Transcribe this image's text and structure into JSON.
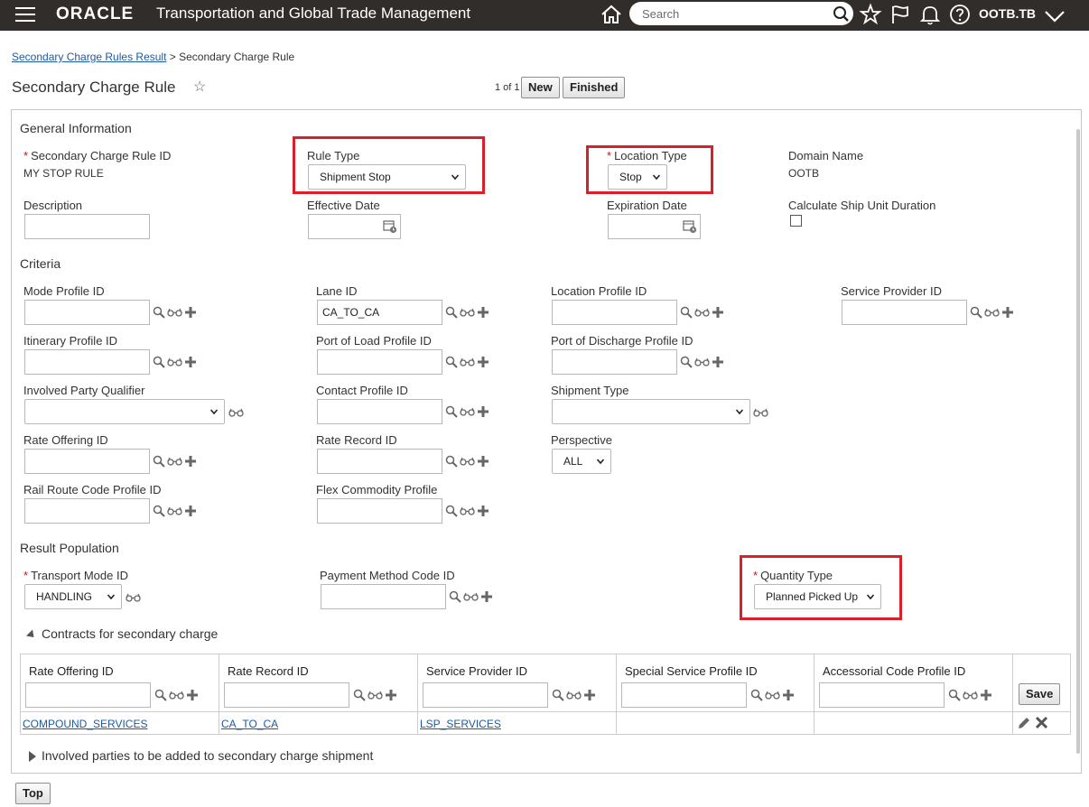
{
  "header": {
    "logo": "ORACLE",
    "app_title": "Transportation and Global Trade Management",
    "search_placeholder": "Search",
    "user": "OOTB.TB"
  },
  "breadcrumb": {
    "parent": "Secondary Charge Rules Result",
    "separator": ">",
    "current": "Secondary Charge Rule"
  },
  "page": {
    "title": "Secondary Charge Rule",
    "favorite_icon": "☆",
    "pager": "1 of 1",
    "new_label": "New",
    "finished_label": "Finished",
    "top_label": "Top"
  },
  "general": {
    "section": "General Information",
    "rule_id_label": "Secondary Charge Rule ID",
    "rule_id_value": "MY STOP RULE",
    "rule_type_label": "Rule Type",
    "rule_type_value": "Shipment Stop",
    "location_type_label": "Location Type",
    "location_type_value": "Stop",
    "domain_label": "Domain Name",
    "domain_value": "OOTB",
    "description_label": "Description",
    "effective_date_label": "Effective Date",
    "expiration_date_label": "Expiration Date",
    "calc_ship_unit_label": "Calculate Ship Unit Duration"
  },
  "criteria": {
    "section": "Criteria",
    "mode_profile": "Mode Profile ID",
    "lane_id": "Lane ID",
    "lane_id_value": "CA_TO_CA",
    "location_profile": "Location Profile ID",
    "service_provider": "Service Provider ID",
    "itinerary_profile": "Itinerary Profile ID",
    "port_load_profile": "Port of Load Profile ID",
    "port_discharge_profile": "Port of Discharge Profile ID",
    "involved_party_qualifier": "Involved Party Qualifier",
    "contact_profile": "Contact Profile ID",
    "shipment_type": "Shipment Type",
    "rate_offering": "Rate Offering ID",
    "rate_record": "Rate Record ID",
    "perspective": "Perspective",
    "perspective_value": "ALL",
    "rail_route_profile": "Rail Route Code Profile ID",
    "flex_commodity_profile": "Flex Commodity Profile"
  },
  "result": {
    "section": "Result Population",
    "transport_mode_label": "Transport Mode ID",
    "transport_mode_value": "HANDLING",
    "payment_method_label": "Payment Method Code ID",
    "quantity_type_label": "Quantity Type",
    "quantity_type_value": "Planned Picked Up"
  },
  "contracts": {
    "section": "Contracts for secondary charge",
    "columns": [
      "Rate Offering ID",
      "Rate Record ID",
      "Service Provider ID",
      "Special Service Profile ID",
      "Accessorial Code Profile ID"
    ],
    "save_label": "Save",
    "row": [
      "COMPOUND_SERVICES",
      "CA_TO_CA",
      "LSP_SERVICES",
      "",
      ""
    ]
  },
  "involved": {
    "section": "Involved parties to be added to secondary charge shipment"
  },
  "colors": {
    "header_bg": "#312d2a",
    "highlight": "#d8202a",
    "link": "#1b5aa6",
    "required": "#c01818"
  }
}
